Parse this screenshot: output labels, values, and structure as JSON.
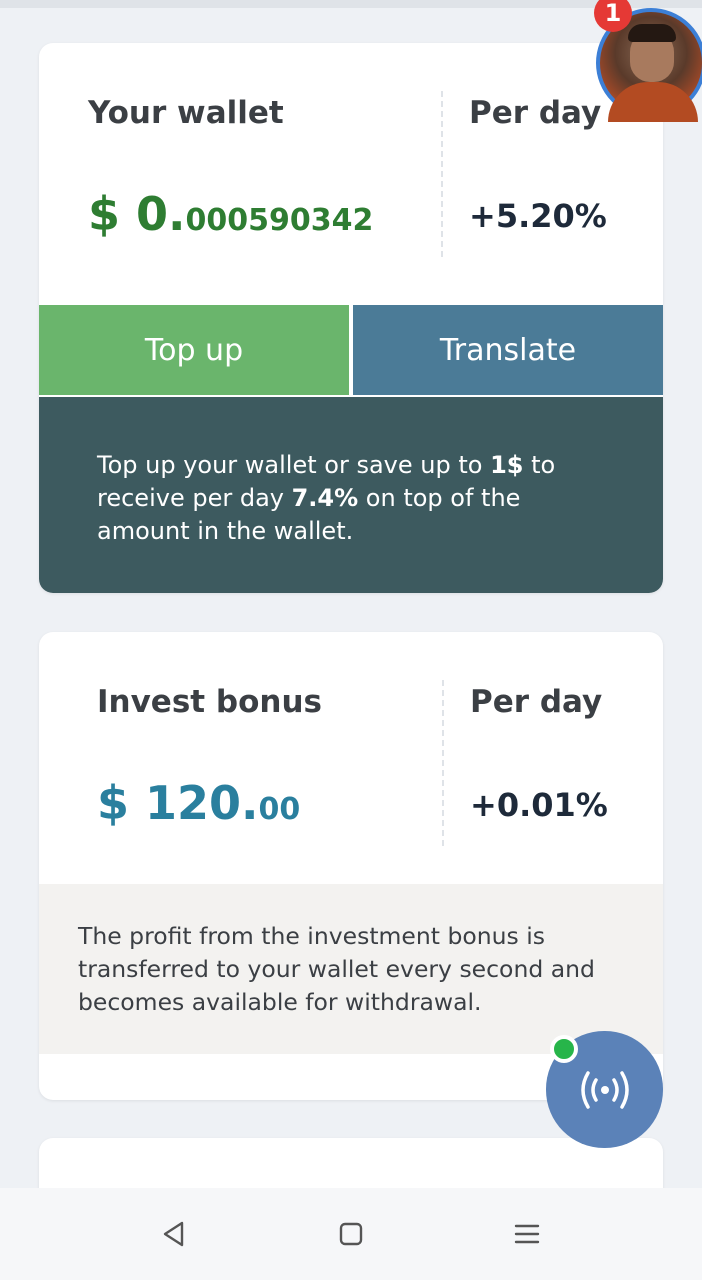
{
  "wallet": {
    "label": "Your wallet",
    "amount_main": "$ 0.",
    "amount_decimal": "000590342",
    "per_day_label": "Per day",
    "per_day_rate": "+5.20%",
    "topup_button": "Top up",
    "translate_button": "Translate",
    "info_part1": "Top up your wallet or save up to ",
    "info_bold1": "1$",
    "info_part2": " to receive per day ",
    "info_bold2": "7.4%",
    "info_part3": " on top of the amount in the wallet."
  },
  "invest": {
    "label": "Invest bonus",
    "amount_main": "$ 120.",
    "amount_decimal": "00",
    "per_day_label": "Per day",
    "per_day_rate": "+0.01%",
    "info": "The profit from the investment bonus is transferred to your wallet every second and becomes available for withdrawal."
  },
  "notification_count": "1",
  "icons": {
    "fab": "broadcast-icon",
    "nav_back": "back-triangle-icon",
    "nav_home": "home-square-icon",
    "nav_menu": "menu-lines-icon"
  },
  "colors": {
    "wallet_amount": "#2e7d32",
    "invest_amount": "#2a7f9e",
    "topup": "#6ab56c",
    "translate": "#4b7b97",
    "info_dark": "#3d5a5f",
    "fab": "#5b82b8",
    "online_dot": "#27b54a",
    "badge": "#e53935"
  }
}
